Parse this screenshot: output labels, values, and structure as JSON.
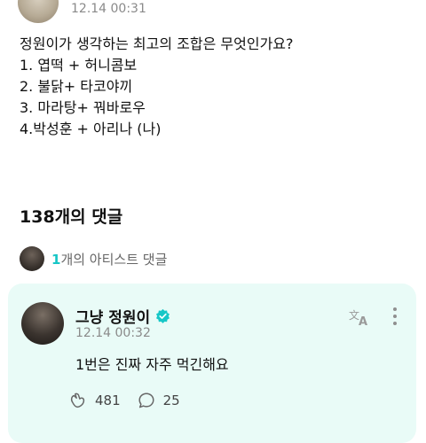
{
  "post": {
    "time": "12.14 00:31",
    "lines": [
      "정원이가 생각하는 최고의 조합은 무엇인가요?",
      "1. 엽떡 + 허니콤보",
      "2. 불닭+ 타코야끼",
      "3. 마라탕+ 꿔바로우",
      "4.박성훈 + 아리나 (나)"
    ]
  },
  "comments": {
    "heading": "138개의 댓글",
    "artist_count": "1",
    "artist_label": "개의 아티스트 댓글"
  },
  "artist_comment": {
    "name": "그냥 정원이",
    "time": "12.14 00:32",
    "text": "1번은 진짜 자주 먹긴해요",
    "like_count": "481",
    "reply_count": "25"
  },
  "colors": {
    "accent": "#17c6c6",
    "card_bg": "#e9fbf7",
    "verified": "#16c7c7"
  },
  "icons": [
    "translate-icon",
    "more-vertical-icon",
    "heart-hands-icon",
    "comment-bubble-icon",
    "verified-badge-icon"
  ]
}
